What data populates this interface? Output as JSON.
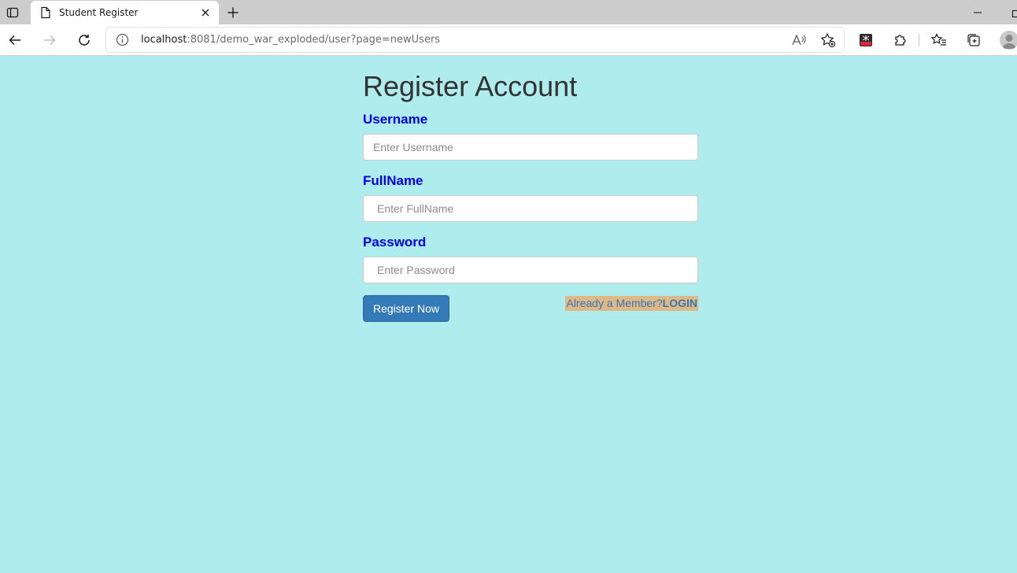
{
  "browser": {
    "tab_title": "Student Register",
    "url_host": "localhost",
    "url_rest": ":8081/demo_war_exploded/user?page=newUsers"
  },
  "page": {
    "title": "Register Account",
    "fields": [
      {
        "label": "Username",
        "placeholder": "Enter Username",
        "value": ""
      },
      {
        "label": "FullName",
        "placeholder": "Enter FullName",
        "value": ""
      },
      {
        "label": "Password",
        "placeholder": "Enter Password",
        "value": ""
      }
    ],
    "submit_label": "Register Now",
    "member_text": "Already a Member?",
    "login_text": "LOGIN"
  },
  "colors": {
    "page_background": "#afecee",
    "label_blue": "#0000ee",
    "button_blue": "#337ab7",
    "link_highlight": "#deb887"
  }
}
